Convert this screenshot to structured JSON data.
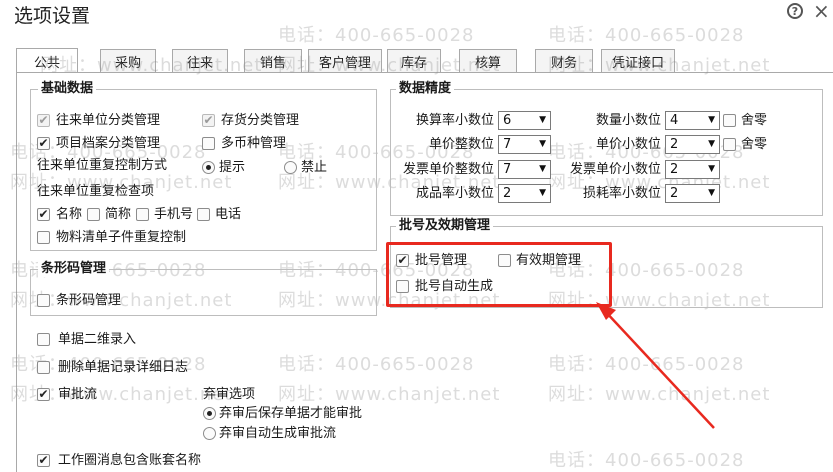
{
  "window": {
    "title": "选项设置",
    "help_icon": "?",
    "close_icon": "×"
  },
  "tabs": [
    "公共",
    "采购",
    "往来",
    "销售",
    "客户管理",
    "库存",
    "核算",
    "财务",
    "凭证接口"
  ],
  "active_tab": "公共",
  "basic": {
    "title": "基础数据",
    "row1": {
      "a": "往来单位分类管理",
      "b": "存货分类管理"
    },
    "row2": {
      "a": "项目档案分类管理",
      "b": "多币种管理"
    },
    "dup_method": {
      "label": "往来单位重复控制方式",
      "opt1": "提示",
      "opt2": "禁止"
    },
    "dup_check": {
      "label": "往来单位重复检查项",
      "name": "名称",
      "short": "简称",
      "phone": "手机号",
      "tel": "电话"
    },
    "bom": "物料清单子件重复控制"
  },
  "barcode": {
    "title": "条形码管理",
    "item": "条形码管理"
  },
  "precision": {
    "title": "数据精度",
    "rows": [
      {
        "l_label": "换算率小数位",
        "l_value": "6",
        "r_label": "数量小数位",
        "r_value": "4",
        "r_extra": "舍零"
      },
      {
        "l_label": "单价整数位",
        "l_value": "7",
        "r_label": "单价小数位",
        "r_value": "2",
        "r_extra": "舍零"
      },
      {
        "l_label": "发票单价整数位",
        "l_value": "7",
        "r_label": "发票单价小数位",
        "r_value": "2"
      },
      {
        "l_label": "成品率小数位",
        "l_value": "2",
        "r_label": "损耗率小数位",
        "r_value": "2"
      }
    ]
  },
  "batch": {
    "title": "批号及效期管理",
    "batch_mgmt": "批号管理",
    "expiry": "有效期管理",
    "auto": "批号自动生成"
  },
  "misc": {
    "qr": "单据二维录入",
    "delete_log": "删除单据记录详细日志",
    "approval": "审批流",
    "abandon": {
      "title": "弃审选项",
      "opt1": "弃审后保存单据才能审批",
      "opt2": "弃审自动生成审批流"
    },
    "workcircle": "工作圈消息包含账套名称"
  },
  "watermark": {
    "phone": "电话：400-665-0028",
    "site": "网址：www.chanjet.net"
  },
  "colors": {
    "highlight": "#e8291f",
    "arrow": "#e8291f"
  }
}
